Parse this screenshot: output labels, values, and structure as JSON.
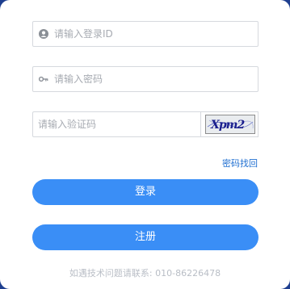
{
  "form": {
    "username": {
      "placeholder": "请输入登录ID",
      "value": "",
      "icon": "user-icon"
    },
    "password": {
      "placeholder": "请输入密码",
      "value": "",
      "icon": "key-icon"
    },
    "captcha": {
      "placeholder": "请输入验证码",
      "value": "",
      "image_text": "Xpm2"
    },
    "forgot_label": "密码找回",
    "login_label": "登录",
    "register_label": "注册"
  },
  "footer": {
    "help_text": "如遇技术问题请联系: 010-86226478"
  },
  "colors": {
    "accent": "#3a8ef6",
    "link": "#1f6fd1",
    "background": "#1e3f8f"
  }
}
